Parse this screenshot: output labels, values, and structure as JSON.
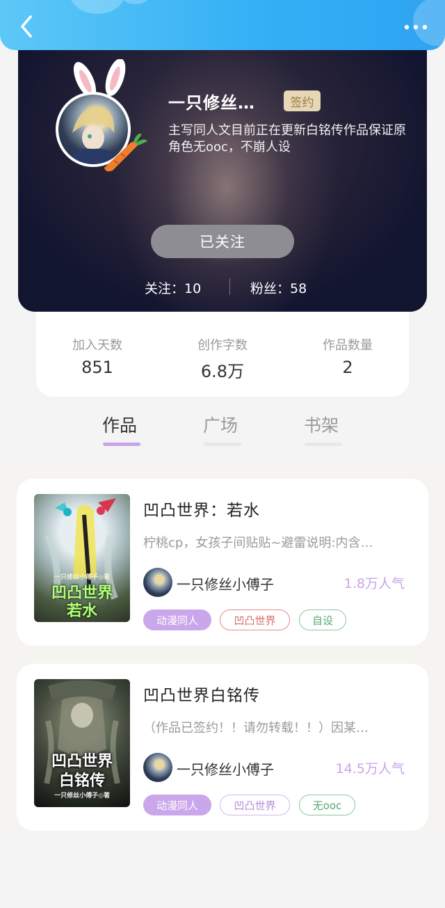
{
  "profile": {
    "nickname": "一只修丝…",
    "sign_badge": "签约",
    "bio": "主写同人文目前正在更新白铭传作品保证原角色无ooc，不崩人设",
    "follow_button": "已关注",
    "following": "关注：10",
    "fans": "粉丝：58"
  },
  "stats": [
    {
      "label": "加入天数",
      "value": "851"
    },
    {
      "label": "创作字数",
      "value": "6.8万"
    },
    {
      "label": "作品数量",
      "value": "2"
    }
  ],
  "tabs": [
    {
      "label": "作品",
      "active": true
    },
    {
      "label": "广场",
      "active": false
    },
    {
      "label": "书架",
      "active": false
    }
  ],
  "works": [
    {
      "title": "凹凸世界：若水",
      "desc": "柠桃cp，女孩子间贴贴~避雷说明:内含…",
      "author": "一只修丝小傅子",
      "popularity": "1.8万人气",
      "cover_small": "一只修丝小傅子◎著",
      "cover_line1": "凹凸世界",
      "cover_line2": "若水",
      "tags": [
        {
          "label": "动漫同人",
          "style": "fill"
        },
        {
          "label": "凹凸世界",
          "style": "red"
        },
        {
          "label": "自设",
          "style": "green"
        }
      ]
    },
    {
      "title": "凹凸世界白铭传",
      "desc": "（作品已签约！！请勿转载！！）因某…",
      "author": "一只修丝小傅子",
      "popularity": "14.5万人气",
      "cover_small": "一只修丝小傅子◎著",
      "cover_line1": "凹凸世界",
      "cover_line2": "白铭传",
      "tags": [
        {
          "label": "动漫同人",
          "style": "fill"
        },
        {
          "label": "凹凸世界",
          "style": "purple"
        },
        {
          "label": "无ooc",
          "style": "green"
        }
      ]
    }
  ],
  "icons": {
    "back": "chevron-left-icon",
    "more": "more-dots-icon"
  },
  "colors": {
    "topbar": "#33aff5",
    "accent": "#c9a4ea",
    "sign_badge": "#e6d7b6"
  }
}
